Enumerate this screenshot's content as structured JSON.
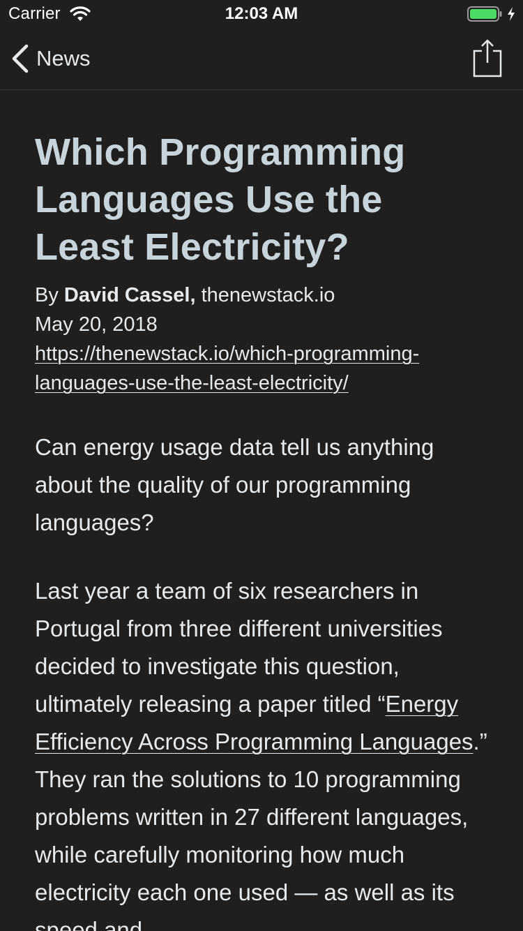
{
  "status_bar": {
    "carrier": "Carrier",
    "time": "12:03 AM",
    "wifi_icon": "wifi-icon",
    "battery_icon": "battery-charging-icon"
  },
  "nav": {
    "back_label": "News",
    "back_icon": "chevron-left-icon",
    "share_icon": "share-icon"
  },
  "article": {
    "title": "Which Programming Languages Use the Least Electricity?",
    "by_prefix": "By ",
    "author": "David Cassel,",
    "source": " thenewstack.io",
    "date": "May 20, 2018",
    "url": "https://thenewstack.io/which-programming-languages-use-the-least-electricity/",
    "paragraph1": "Can energy usage data tell us anything about the quality of our programming languages?",
    "paragraph2_before_link": "Last year a team of six researchers in Portugal from three different universities decided to investigate this question, ultimately releasing a paper titled “",
    "paragraph2_link": "Energy Efficiency Across Programming Languages",
    "paragraph2_after_link": ".” They ran the solutions to 10 programming problems written in 27 different languages, while carefully monitoring how much electricity each one used — as well as its speed and"
  },
  "colors": {
    "background": "#1f1f1f",
    "title": "#c8d4dc",
    "text": "#e7eaed",
    "battery_fill": "#4cd964"
  }
}
